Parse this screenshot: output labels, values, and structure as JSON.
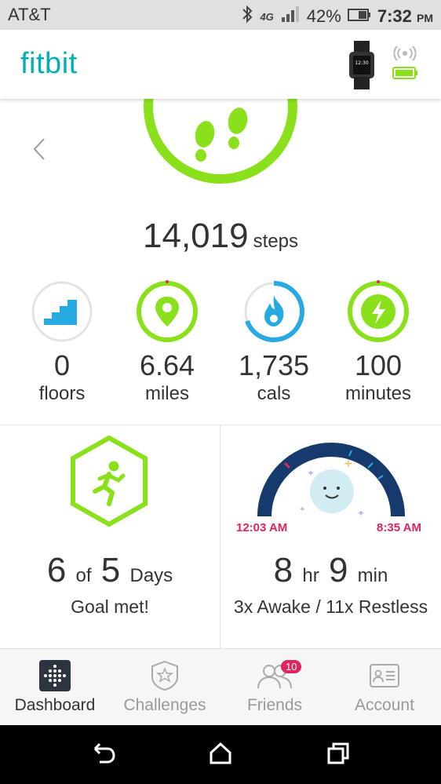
{
  "status_bar": {
    "carrier": "AT&T",
    "battery": "42%",
    "time": "7:32",
    "ampm": "PM",
    "network": "4G LTE"
  },
  "app": {
    "logo": "fitbit"
  },
  "steps": {
    "value": "14,019",
    "unit": "steps"
  },
  "stats": [
    {
      "value": "0",
      "label": "floors",
      "icon": "stairs-icon",
      "progress": 0.0
    },
    {
      "value": "6.64",
      "label": "miles",
      "icon": "location-pin-icon",
      "progress": 1.0
    },
    {
      "value": "1,735",
      "label": "cals",
      "icon": "flame-icon",
      "progress": 0.7
    },
    {
      "value": "100",
      "label": "minutes",
      "icon": "lightning-icon",
      "progress": 1.0
    }
  ],
  "exercise_tile": {
    "count": "6",
    "of": "of",
    "goal": "5",
    "days": "Days",
    "caption": "Goal met!"
  },
  "sleep_tile": {
    "start": "12:03 AM",
    "end": "8:35 AM",
    "hours": "8",
    "hr": "hr",
    "minutes": "9",
    "min": "min",
    "caption": "3x Awake / 11x Restless"
  },
  "nav": [
    {
      "label": "Dashboard",
      "icon": "dashboard-icon",
      "active": true
    },
    {
      "label": "Challenges",
      "icon": "challenges-icon"
    },
    {
      "label": "Friends",
      "icon": "friends-icon",
      "badge": "10"
    },
    {
      "label": "Account",
      "icon": "account-icon"
    }
  ],
  "colors": {
    "brand": "#00b0b9",
    "green": "#8ae01b",
    "blue": "#27a9e1",
    "pink": "#e0245e",
    "navy": "#163a6b"
  }
}
